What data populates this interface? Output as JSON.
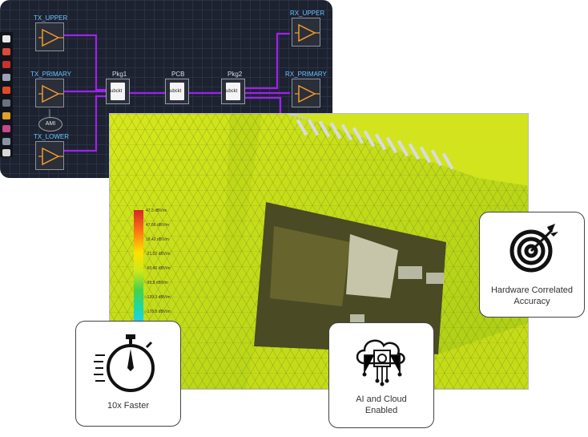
{
  "schematic": {
    "labels": {
      "tx_upper": "TX_UPPER",
      "tx_primary": "TX_PRIMARY",
      "tx_lower": "TX_LOWER",
      "rx_upper": "RX_UPPER",
      "rx_primary": "RX_PRIMARY",
      "pkg1": "Pkg1",
      "pcb": "PCB",
      "pkg2": "Pkg2",
      "ami": "AMI",
      "subckt": "subckt"
    }
  },
  "simulation": {
    "legend": [
      "47.3 dBV/m",
      "47.86 dBV/m",
      "18.42 dBV/m",
      "-21.02 dBV/m",
      "-60.46 dBV/m",
      "-99.9 dBV/m",
      "-139.3 dBV/m",
      "-178.8 dBV/m"
    ]
  },
  "features": {
    "accuracy": "Hardware Correlated Accuracy",
    "speed": "10x Faster",
    "ai": "AI and Cloud Enabled"
  },
  "colors": {
    "wire": "#a020f0",
    "accent": "#69c5ff",
    "mesh": "#c8e61e"
  }
}
